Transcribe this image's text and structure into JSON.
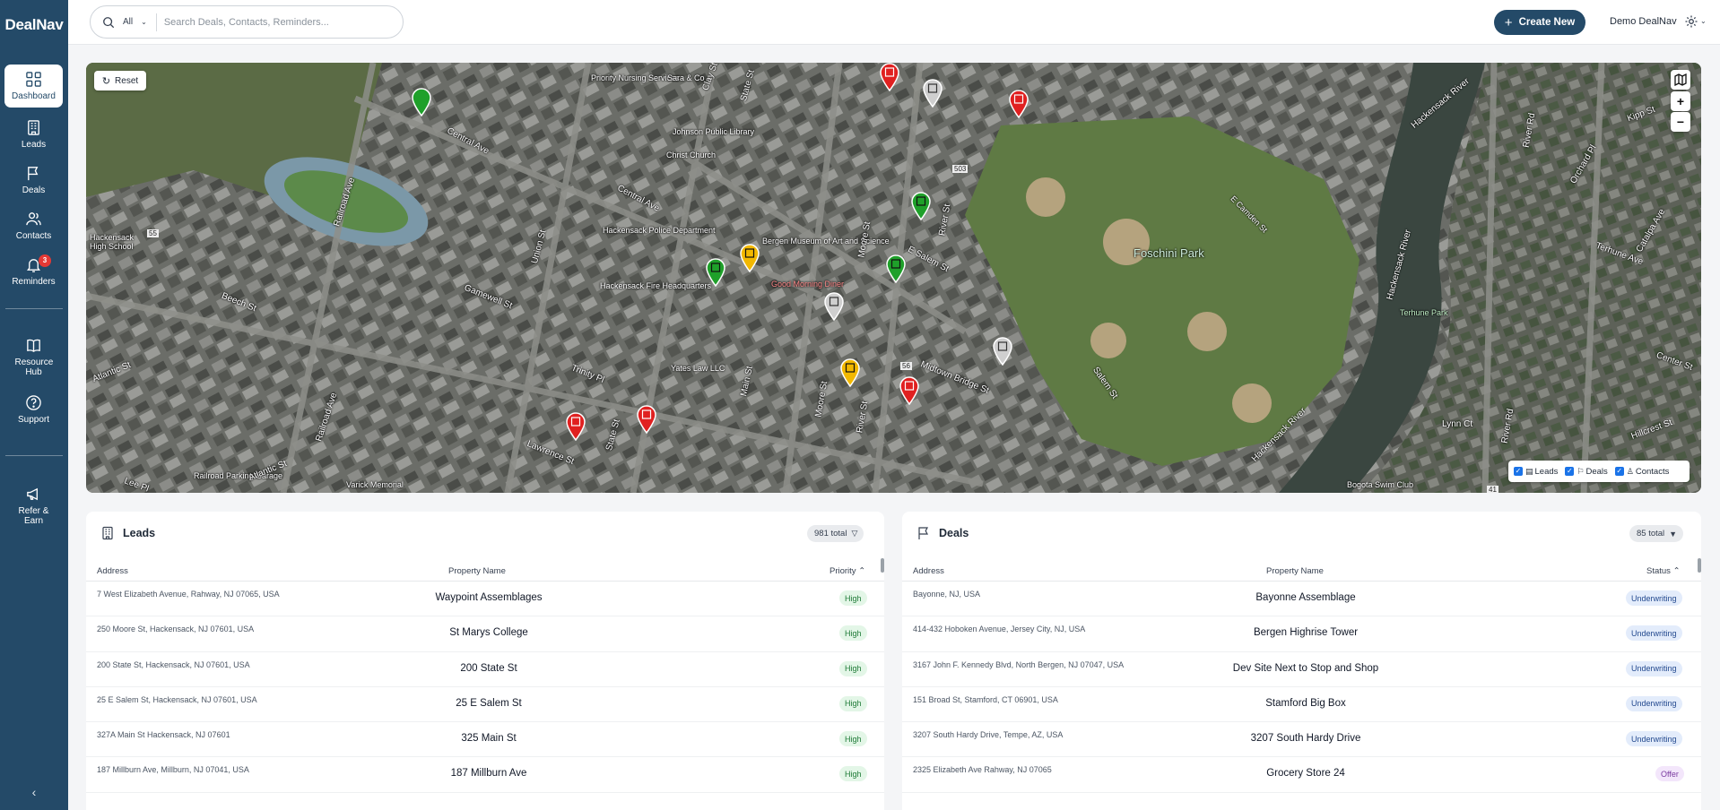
{
  "app": {
    "logo": "DealNav"
  },
  "sidebar": {
    "items": [
      {
        "label": "Dashboard",
        "icon": "grid-icon"
      },
      {
        "label": "Leads",
        "icon": "building-icon"
      },
      {
        "label": "Deals",
        "icon": "flag-icon"
      },
      {
        "label": "Contacts",
        "icon": "users-icon"
      },
      {
        "label": "Reminders",
        "icon": "bell-icon",
        "badge": "3"
      },
      {
        "label": "Resource Hub",
        "icon": "book-icon"
      },
      {
        "label": "Support",
        "icon": "help-icon"
      },
      {
        "label": "Refer & Earn",
        "icon": "megaphone-icon"
      }
    ],
    "collapse": "‹"
  },
  "topbar": {
    "search_scope": "All",
    "search_placeholder": "Search Deals, Contacts, Reminders...",
    "create_label": "Create New",
    "user_name": "Demo DealNav"
  },
  "map": {
    "reset_label": "Reset",
    "zoom_in": "+",
    "zoom_out": "−",
    "legend": {
      "leads": "Leads",
      "deals": "Deals",
      "contacts": "Contacts"
    },
    "labels": {
      "nursing": "Priority Nursing Services",
      "library": "Johnson Public Library",
      "church": "Christ Church",
      "fire": "Hackensack Fire Headquarters",
      "police": "Hackensack Police Department",
      "museum": "Bergen Museum of Art and Science",
      "diner": "Good Morning Diner",
      "law": "Yates Law LLC",
      "park": "Foschini Park",
      "terhune": "Terhune Park",
      "garage": "Railroad Parking Garage",
      "varick": "Varick Memorial",
      "swim": "Bogota Swim Club",
      "highschool": "Hackensack High School",
      "river1": "Hackensack River",
      "river2": "Hackensack River",
      "river3": "Hackensack River",
      "central1": "Central Ave",
      "central2": "Central Ave",
      "railroad1": "Railroad Ave",
      "railroad2": "Railroad Ave",
      "union": "Union St",
      "state1": "State St",
      "state2": "State St",
      "main": "Main St",
      "moore1": "Moore St",
      "moore2": "Moore St",
      "river_st": "River St",
      "river_st2": "River St",
      "esalem": "E Salem St",
      "midtown": "Midtown Bridge St",
      "salem": "Salem St",
      "beech": "Beech St",
      "gamewell": "Gamewell St",
      "trinity": "Trinity Pl",
      "atlantic1": "Atlantic St",
      "atlantic2": "Atlantic St",
      "lawrence": "Lawrence St",
      "clay": "Clay St",
      "lynn": "Lynn Ct",
      "hillcrest": "Hillcrest St",
      "kipp": "Kipp St",
      "orchard": "Orchard Pl",
      "catalpa": "Catalpa Ave",
      "terhune_ave": "Terhune Ave",
      "center": "Center St",
      "river_rd1": "River Rd",
      "river_rd2": "River Rd",
      "lee": "Lee Pl",
      "ecamden": "E Camden St",
      "route503": "503",
      "route56": "56",
      "route55": "55",
      "route41": "41",
      "sara": "Sara & Co"
    }
  },
  "leads": {
    "title": "Leads",
    "total": "981 total",
    "columns": {
      "address": "Address",
      "property": "Property Name",
      "priority": "Priority"
    },
    "rows": [
      {
        "address": "7 West Elizabeth Avenue, Rahway, NJ 07065, USA",
        "property": "Waypoint Assemblages",
        "priority": "High"
      },
      {
        "address": "250 Moore St, Hackensack, NJ 07601, USA",
        "property": "St Marys College",
        "priority": "High"
      },
      {
        "address": "200 State St, Hackensack, NJ 07601, USA",
        "property": "200 State St",
        "priority": "High"
      },
      {
        "address": "25 E Salem St, Hackensack, NJ 07601, USA",
        "property": "25 E Salem St",
        "priority": "High"
      },
      {
        "address": "327A Main St Hackensack, NJ 07601",
        "property": "325 Main St",
        "priority": "High"
      },
      {
        "address": "187 Millburn Ave, Millburn, NJ 07041, USA",
        "property": "187 Millburn Ave",
        "priority": "High"
      }
    ]
  },
  "deals": {
    "title": "Deals",
    "total": "85 total",
    "columns": {
      "address": "Address",
      "property": "Property Name",
      "status": "Status"
    },
    "rows": [
      {
        "address": "Bayonne, NJ, USA",
        "property": "Bayonne Assemblage",
        "status": "Underwriting",
        "kind": "uw"
      },
      {
        "address": "414-432 Hoboken Avenue, Jersey City, NJ, USA",
        "property": "Bergen Highrise Tower",
        "status": "Underwriting",
        "kind": "uw"
      },
      {
        "address": "3167 John F. Kennedy Blvd, North Bergen, NJ 07047, USA",
        "property": "Dev Site Next to Stop and Shop",
        "status": "Underwriting",
        "kind": "uw"
      },
      {
        "address": "151 Broad St, Stamford, CT 06901, USA",
        "property": "Stamford Big Box",
        "status": "Underwriting",
        "kind": "uw"
      },
      {
        "address": "3207 South Hardy Drive, Tempe, AZ, USA",
        "property": "3207 South Hardy Drive",
        "status": "Underwriting",
        "kind": "uw"
      },
      {
        "address": "2325 Elizabeth Ave Rahway, NJ 07065",
        "property": "Grocery Store 24",
        "status": "Offer",
        "kind": "offer"
      }
    ]
  },
  "colors": {
    "sidebar": "#244a68",
    "marker_red": "#e02020",
    "marker_green": "#1fa02a",
    "marker_yellow": "#f2b800",
    "marker_gray": "#cfcfcf"
  }
}
